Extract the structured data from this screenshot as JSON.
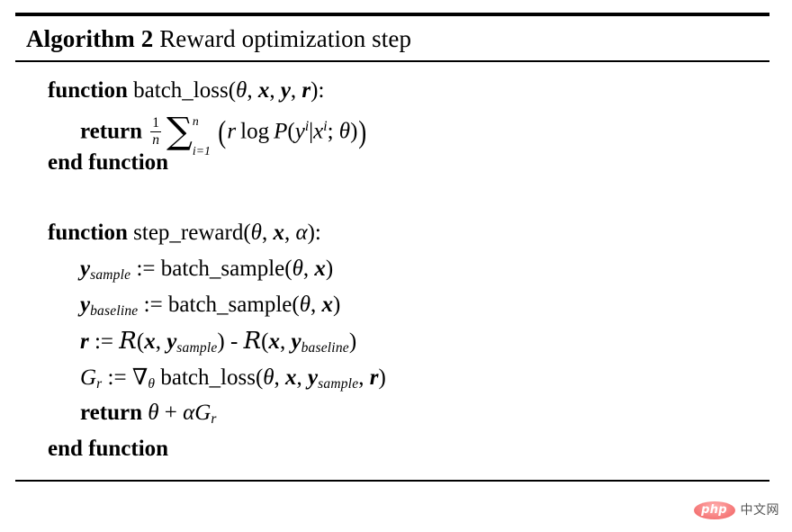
{
  "document": {
    "type": "algorithm-float",
    "background_color": "#ffffff",
    "text_color": "#000000"
  },
  "algorithm": {
    "label": "Algorithm 2",
    "title": "Reward optimization step",
    "caption_full": "Algorithm 2 Reward optimization step",
    "keywords": {
      "function": "function",
      "end_function": "end function",
      "return": "return"
    },
    "lines": [
      {
        "id": "l1",
        "indent": 0,
        "plain": "function batch_loss(θ, x, y, r):",
        "kind": "function-header",
        "name": "batch_loss",
        "params": [
          "θ",
          "x",
          "y",
          "r"
        ]
      },
      {
        "id": "l2",
        "indent": 1,
        "plain": "return 1/n Σ_{i=1}^{n} ( r log P(y^i | x^i ; θ) )",
        "kind": "return"
      },
      {
        "id": "l3",
        "indent": 0,
        "plain": "end function",
        "kind": "end"
      },
      {
        "id": "l4",
        "indent": 0,
        "plain": "",
        "kind": "blank"
      },
      {
        "id": "l5",
        "indent": 0,
        "plain": "function step_reward(θ, x, α):",
        "kind": "function-header",
        "name": "step_reward",
        "params": [
          "θ",
          "x",
          "α"
        ]
      },
      {
        "id": "l6",
        "indent": 1,
        "plain": "y_sample := batch_sample(θ, x)",
        "kind": "assign"
      },
      {
        "id": "l7",
        "indent": 1,
        "plain": "y_baseline := batch_sample(θ, x)",
        "kind": "assign"
      },
      {
        "id": "l8",
        "indent": 1,
        "plain": "r := R(x, y_sample) - R(x, y_baseline)",
        "kind": "assign"
      },
      {
        "id": "l9",
        "indent": 1,
        "plain": "G_r := ∇_θ batch_loss(θ, x, y_sample, r)",
        "kind": "assign"
      },
      {
        "id": "l10",
        "indent": 1,
        "plain": "return θ + αG_r",
        "kind": "return"
      },
      {
        "id": "l11",
        "indent": 0,
        "plain": "end function",
        "kind": "end"
      }
    ],
    "symbols": {
      "theta": "θ",
      "alpha": "α",
      "vec_x": "x",
      "vec_y": "y",
      "vec_r": "r",
      "reward_fn": "R",
      "gradient": "G",
      "nabla": "∇",
      "sigma": "∑",
      "assign": ":=",
      "minus": "-",
      "plus": "+",
      "log": "log",
      "prob": "P",
      "n": "n",
      "i": "i",
      "one": "1",
      "sub_sample": "sample",
      "sub_baseline": "baseline",
      "sub_r": "r",
      "fn_batch_sample": "batch_sample",
      "fn_batch_loss": "batch_loss"
    }
  },
  "watermark": {
    "badge_text": "php",
    "site_text": "中文网",
    "badge_color": "#ef5f5f",
    "text_color": "#555555"
  }
}
